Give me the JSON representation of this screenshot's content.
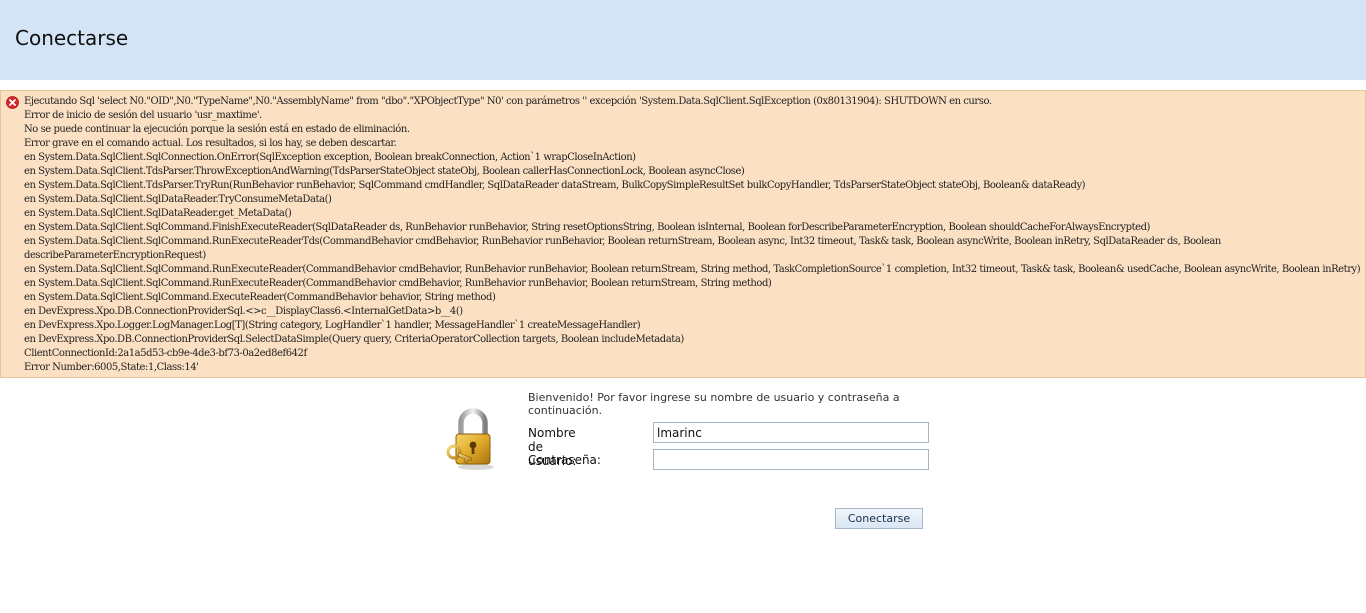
{
  "header": {
    "title": "Conectarse"
  },
  "error": {
    "icon": "error-icon",
    "lines": [
      "Ejecutando Sql 'select N0.\"OID\",N0.\"TypeName\",N0.\"AssemblyName\" from \"dbo\".\"XPObjectType\" N0' con parámetros '' excepción 'System.Data.SqlClient.SqlException (0x80131904): SHUTDOWN en curso.",
      "Error de inicio de sesión del usuario 'usr_maxtime'.",
      "No se puede continuar la ejecución porque la sesión está en estado de eliminación.",
      "Error grave en el comando actual. Los resultados, si los hay, se deben descartar.",
      "en System.Data.SqlClient.SqlConnection.OnError(SqlException exception, Boolean breakConnection, Action`1 wrapCloseInAction)",
      "en System.Data.SqlClient.TdsParser.ThrowExceptionAndWarning(TdsParserStateObject stateObj, Boolean callerHasConnectionLock, Boolean asyncClose)",
      "en System.Data.SqlClient.TdsParser.TryRun(RunBehavior runBehavior, SqlCommand cmdHandler, SqlDataReader dataStream, BulkCopySimpleResultSet bulkCopyHandler, TdsParserStateObject stateObj, Boolean& dataReady)",
      "en System.Data.SqlClient.SqlDataReader.TryConsumeMetaData()",
      "en System.Data.SqlClient.SqlDataReader.get_MetaData()",
      "en System.Data.SqlClient.SqlCommand.FinishExecuteReader(SqlDataReader ds, RunBehavior runBehavior, String resetOptionsString, Boolean isInternal, Boolean forDescribeParameterEncryption, Boolean shouldCacheForAlwaysEncrypted)",
      "en System.Data.SqlClient.SqlCommand.RunExecuteReaderTds(CommandBehavior cmdBehavior, RunBehavior runBehavior, Boolean returnStream, Boolean async, Int32 timeout, Task& task, Boolean asyncWrite, Boolean inRetry, SqlDataReader ds, Boolean",
      "describeParameterEncryptionRequest)",
      "en System.Data.SqlClient.SqlCommand.RunExecuteReader(CommandBehavior cmdBehavior, RunBehavior runBehavior, Boolean returnStream, String method, TaskCompletionSource`1 completion, Int32 timeout, Task& task, Boolean& usedCache, Boolean asyncWrite, Boolean inRetry)",
      "en System.Data.SqlClient.SqlCommand.RunExecuteReader(CommandBehavior cmdBehavior, RunBehavior runBehavior, Boolean returnStream, String method)",
      "en System.Data.SqlClient.SqlCommand.ExecuteReader(CommandBehavior behavior, String method)",
      "en DevExpress.Xpo.DB.ConnectionProviderSql.<>c__DisplayClass6.<InternalGetData>b__4()",
      "en DevExpress.Xpo.Logger.LogManager.Log[T](String category, LogHandler`1 handler, MessageHandler`1 createMessageHandler)",
      "en DevExpress.Xpo.DB.ConnectionProviderSql.SelectDataSimple(Query query, CriteriaOperatorCollection targets, Boolean includeMetadata)",
      "ClientConnectionId:2a1a5d53-cb9e-4de3-bf73-0a2ed8ef642f",
      "Error Number:6005,State:1,Class:14'"
    ]
  },
  "login": {
    "icon": "lock-and-key-icon",
    "welcome": "Bienvenido! Por favor ingrese su nombre de usuario y contraseña a continuación.",
    "username_label": "Nombre de usuario:",
    "username_value": "lmarinc",
    "password_label": "Contraseña:",
    "password_value": "",
    "submit_label": "Conectarse"
  },
  "colors": {
    "header_bg": "#d2e4f6",
    "error_bg": "#fbe0c4",
    "error_icon": "#d9272a"
  }
}
